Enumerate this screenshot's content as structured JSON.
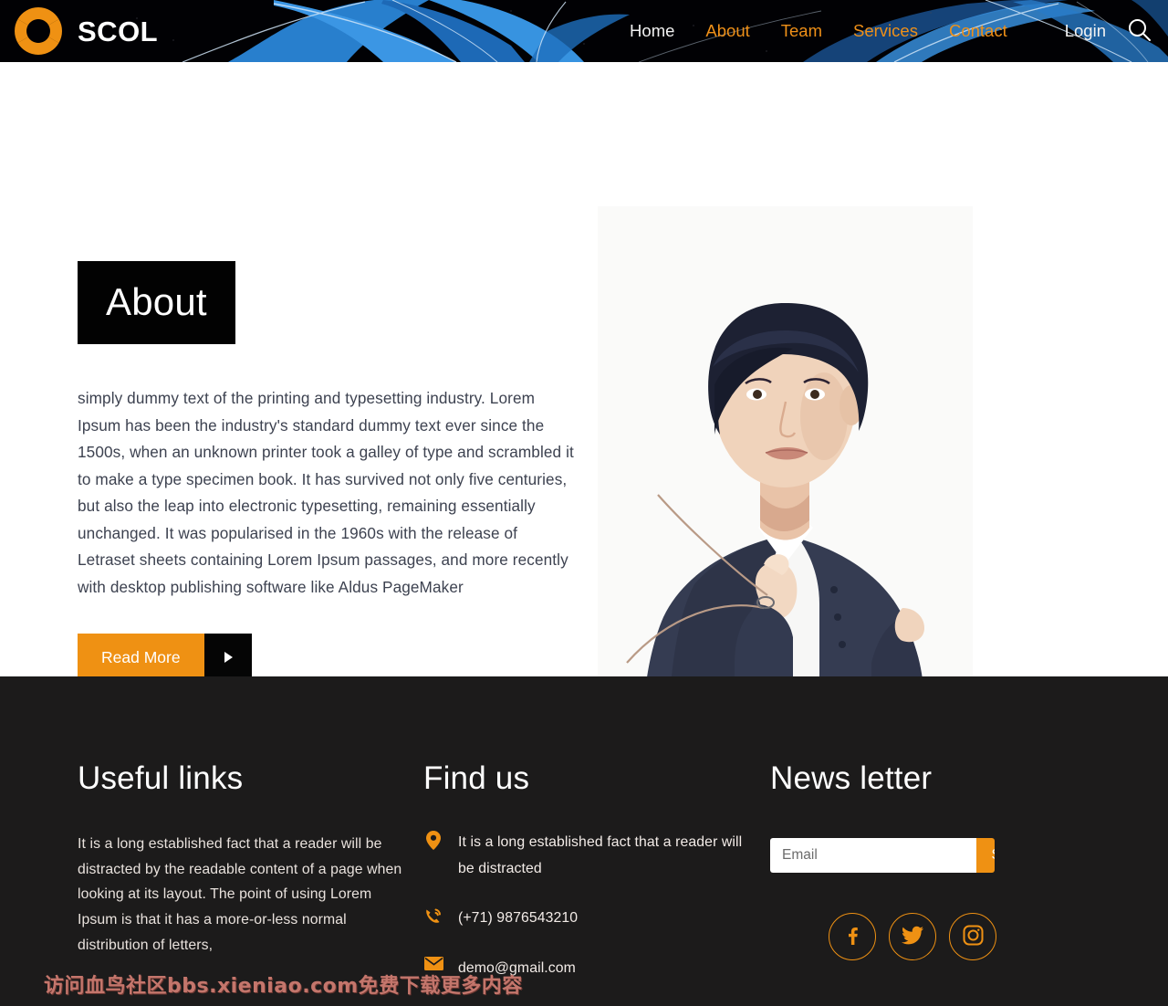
{
  "header": {
    "brand_name": "SCOL",
    "logo_icon": "lifebuoy-ring-icon",
    "search_icon": "search-icon",
    "nav_items": [
      {
        "label": "Home",
        "style": "white"
      },
      {
        "label": "About",
        "style": "accent"
      },
      {
        "label": "Team",
        "style": "accent"
      },
      {
        "label": "Services",
        "style": "accent"
      },
      {
        "label": "Contact",
        "style": "accent"
      }
    ],
    "login_label": "Login"
  },
  "about": {
    "heading": "About",
    "paragraph": "simply dummy text of the printing and typesetting industry. Lorem Ipsum has been the industry's standard dummy text ever since the 1500s, when an unknown printer took a galley of type and scrambled it to make a type specimen book. It has survived not only five centuries, but also the leap into electronic typesetting, remaining essentially unchanged. It was popularised in the 1960s with the release of Letraset sheets containing Lorem Ipsum passages, and more recently with desktop publishing software like Aldus PageMaker",
    "read_more_label": "Read More",
    "play_icon": "play-triangle-icon",
    "photo_alt": "businesswoman-portrait"
  },
  "footer": {
    "useful_links": {
      "title": "Useful links",
      "body": "It is a long established fact that a reader will be distracted by the readable content of a page when looking at its layout. The point of using Lorem Ipsum is that it has a more-or-less normal distribution of letters,"
    },
    "find_us": {
      "title": "Find us",
      "address": "It is a long established fact that a reader will be distracted",
      "address_icon": "location-pin-icon",
      "phone": "(+71) 9876543210",
      "phone_icon": "phone-icon",
      "email": "demo@gmail.com",
      "email_icon": "envelope-icon"
    },
    "newsletter": {
      "title": "News letter",
      "email_placeholder": "Email",
      "email_value": "",
      "subscribe_label": "Subscribe",
      "social": [
        {
          "name": "facebook-icon"
        },
        {
          "name": "twitter-icon"
        },
        {
          "name": "instagram-icon"
        }
      ]
    },
    "watermark": "访问血鸟社区bbs.xieniao.com免费下载更多内容"
  },
  "colors": {
    "accent_orange": "#ef9113",
    "header_black": "#010104",
    "footer_dark": "#1c1b1b",
    "heading_box": "#020202",
    "body_text": "#3d4250",
    "ribbon_blue": "#2f8fe0",
    "watermark_red": "#c4766c"
  }
}
